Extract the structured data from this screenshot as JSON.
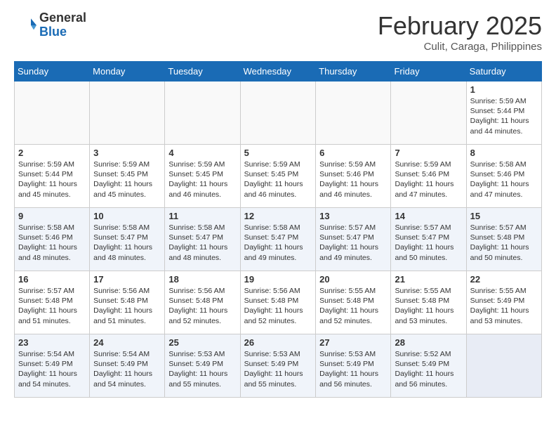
{
  "header": {
    "logo_general": "General",
    "logo_blue": "Blue",
    "month_title": "February 2025",
    "location": "Culit, Caraga, Philippines"
  },
  "days_of_week": [
    "Sunday",
    "Monday",
    "Tuesday",
    "Wednesday",
    "Thursday",
    "Friday",
    "Saturday"
  ],
  "weeks": [
    {
      "alt": false,
      "days": [
        {
          "num": "",
          "info": ""
        },
        {
          "num": "",
          "info": ""
        },
        {
          "num": "",
          "info": ""
        },
        {
          "num": "",
          "info": ""
        },
        {
          "num": "",
          "info": ""
        },
        {
          "num": "",
          "info": ""
        },
        {
          "num": "1",
          "info": "Sunrise: 5:59 AM\nSunset: 5:44 PM\nDaylight: 11 hours\nand 44 minutes."
        }
      ]
    },
    {
      "alt": false,
      "days": [
        {
          "num": "2",
          "info": "Sunrise: 5:59 AM\nSunset: 5:44 PM\nDaylight: 11 hours\nand 45 minutes."
        },
        {
          "num": "3",
          "info": "Sunrise: 5:59 AM\nSunset: 5:45 PM\nDaylight: 11 hours\nand 45 minutes."
        },
        {
          "num": "4",
          "info": "Sunrise: 5:59 AM\nSunset: 5:45 PM\nDaylight: 11 hours\nand 46 minutes."
        },
        {
          "num": "5",
          "info": "Sunrise: 5:59 AM\nSunset: 5:45 PM\nDaylight: 11 hours\nand 46 minutes."
        },
        {
          "num": "6",
          "info": "Sunrise: 5:59 AM\nSunset: 5:46 PM\nDaylight: 11 hours\nand 46 minutes."
        },
        {
          "num": "7",
          "info": "Sunrise: 5:59 AM\nSunset: 5:46 PM\nDaylight: 11 hours\nand 47 minutes."
        },
        {
          "num": "8",
          "info": "Sunrise: 5:58 AM\nSunset: 5:46 PM\nDaylight: 11 hours\nand 47 minutes."
        }
      ]
    },
    {
      "alt": true,
      "days": [
        {
          "num": "9",
          "info": "Sunrise: 5:58 AM\nSunset: 5:46 PM\nDaylight: 11 hours\nand 48 minutes."
        },
        {
          "num": "10",
          "info": "Sunrise: 5:58 AM\nSunset: 5:47 PM\nDaylight: 11 hours\nand 48 minutes."
        },
        {
          "num": "11",
          "info": "Sunrise: 5:58 AM\nSunset: 5:47 PM\nDaylight: 11 hours\nand 48 minutes."
        },
        {
          "num": "12",
          "info": "Sunrise: 5:58 AM\nSunset: 5:47 PM\nDaylight: 11 hours\nand 49 minutes."
        },
        {
          "num": "13",
          "info": "Sunrise: 5:57 AM\nSunset: 5:47 PM\nDaylight: 11 hours\nand 49 minutes."
        },
        {
          "num": "14",
          "info": "Sunrise: 5:57 AM\nSunset: 5:47 PM\nDaylight: 11 hours\nand 50 minutes."
        },
        {
          "num": "15",
          "info": "Sunrise: 5:57 AM\nSunset: 5:48 PM\nDaylight: 11 hours\nand 50 minutes."
        }
      ]
    },
    {
      "alt": false,
      "days": [
        {
          "num": "16",
          "info": "Sunrise: 5:57 AM\nSunset: 5:48 PM\nDaylight: 11 hours\nand 51 minutes."
        },
        {
          "num": "17",
          "info": "Sunrise: 5:56 AM\nSunset: 5:48 PM\nDaylight: 11 hours\nand 51 minutes."
        },
        {
          "num": "18",
          "info": "Sunrise: 5:56 AM\nSunset: 5:48 PM\nDaylight: 11 hours\nand 52 minutes."
        },
        {
          "num": "19",
          "info": "Sunrise: 5:56 AM\nSunset: 5:48 PM\nDaylight: 11 hours\nand 52 minutes."
        },
        {
          "num": "20",
          "info": "Sunrise: 5:55 AM\nSunset: 5:48 PM\nDaylight: 11 hours\nand 52 minutes."
        },
        {
          "num": "21",
          "info": "Sunrise: 5:55 AM\nSunset: 5:48 PM\nDaylight: 11 hours\nand 53 minutes."
        },
        {
          "num": "22",
          "info": "Sunrise: 5:55 AM\nSunset: 5:49 PM\nDaylight: 11 hours\nand 53 minutes."
        }
      ]
    },
    {
      "alt": true,
      "days": [
        {
          "num": "23",
          "info": "Sunrise: 5:54 AM\nSunset: 5:49 PM\nDaylight: 11 hours\nand 54 minutes."
        },
        {
          "num": "24",
          "info": "Sunrise: 5:54 AM\nSunset: 5:49 PM\nDaylight: 11 hours\nand 54 minutes."
        },
        {
          "num": "25",
          "info": "Sunrise: 5:53 AM\nSunset: 5:49 PM\nDaylight: 11 hours\nand 55 minutes."
        },
        {
          "num": "26",
          "info": "Sunrise: 5:53 AM\nSunset: 5:49 PM\nDaylight: 11 hours\nand 55 minutes."
        },
        {
          "num": "27",
          "info": "Sunrise: 5:53 AM\nSunset: 5:49 PM\nDaylight: 11 hours\nand 56 minutes."
        },
        {
          "num": "28",
          "info": "Sunrise: 5:52 AM\nSunset: 5:49 PM\nDaylight: 11 hours\nand 56 minutes."
        },
        {
          "num": "",
          "info": ""
        }
      ]
    }
  ]
}
